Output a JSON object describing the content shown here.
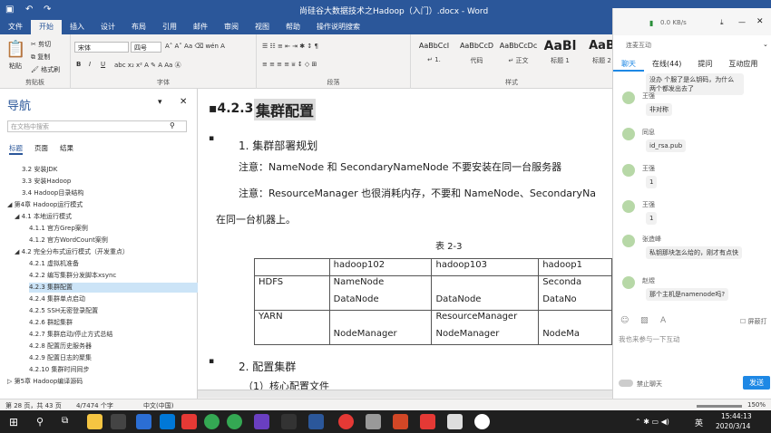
{
  "titlebar": {
    "title": "尚硅谷大数据技术之Hadoop（入门）.docx - Word"
  },
  "tabs": [
    "文件",
    "开始",
    "插入",
    "设计",
    "布局",
    "引用",
    "邮件",
    "审阅",
    "视图",
    "帮助",
    "操作说明搜索"
  ],
  "ribbon": {
    "clipboard": {
      "paste": "粘贴",
      "cut": "剪切",
      "copy": "复制",
      "format_painter": "格式刷",
      "label": "剪贴板"
    },
    "font": {
      "name": "宋体",
      "size": "四号",
      "label": "字体",
      "bold": "B",
      "italic": "I",
      "underline": "U"
    },
    "paragraph": {
      "label": "段落"
    },
    "styles": {
      "label": "样式",
      "items": [
        {
          "preview": "AaBbCcI",
          "name": "↵ 1."
        },
        {
          "preview": "AaBbCcD",
          "name": "代码"
        },
        {
          "preview": "AaBbCcDc",
          "name": "↵ 正文"
        },
        {
          "preview": "AaBl",
          "name": "标题 1"
        },
        {
          "preview": "AaB",
          "name": "标题 2"
        }
      ]
    }
  },
  "nav": {
    "title": "导航",
    "search_placeholder": "在文档中搜索",
    "tabs": [
      "标题",
      "页面",
      "结果"
    ],
    "items": [
      {
        "label": "3.2 安装JDK",
        "indent": 2,
        "sel": false
      },
      {
        "label": "3.3 安装Hadoop",
        "indent": 2,
        "sel": false
      },
      {
        "label": "3.4 Hadoop目录结构",
        "indent": 2,
        "sel": false
      },
      {
        "label": "◢ 第4章 Hadoop运行模式",
        "indent": 0,
        "sel": false
      },
      {
        "label": "◢ 4.1 本地运行模式",
        "indent": 1,
        "sel": false
      },
      {
        "label": "4.1.1 官方Grep案例",
        "indent": 3,
        "sel": false
      },
      {
        "label": "4.1.2 官方WordCount案例",
        "indent": 3,
        "sel": false
      },
      {
        "label": "◢ 4.2 完全分布式运行模式（开发重点）",
        "indent": 1,
        "sel": false
      },
      {
        "label": "4.2.1 虚拟机准备",
        "indent": 3,
        "sel": false
      },
      {
        "label": "4.2.2 编写集群分发脚本xsync",
        "indent": 3,
        "sel": false
      },
      {
        "label": "4.2.3 集群配置",
        "indent": 3,
        "sel": true
      },
      {
        "label": "4.2.4 集群单点启动",
        "indent": 3,
        "sel": false
      },
      {
        "label": "4.2.5 SSH无密登录配置",
        "indent": 3,
        "sel": false
      },
      {
        "label": "4.2.6 群起集群",
        "indent": 3,
        "sel": false
      },
      {
        "label": "4.2.7 集群启动/停止方式总结",
        "indent": 3,
        "sel": false
      },
      {
        "label": "4.2.8 配置历史服务器",
        "indent": 3,
        "sel": false
      },
      {
        "label": "4.2.9 配置日志的聚集",
        "indent": 3,
        "sel": false
      },
      {
        "label": "4.2.10 集群时间同步",
        "indent": 3,
        "sel": false
      },
      {
        "label": "▷ 第5章 Hadoop编译源码",
        "indent": 0,
        "sel": false
      }
    ]
  },
  "doc": {
    "heading_num": "4.2.3",
    "heading": "集群配置",
    "sub1": "1.   集群部署规划",
    "note1": "注意：NameNode 和 SecondaryNameNode 不要安装在同一台服务器",
    "note2": "注意：ResourceManager 也很消耗内存，不要和 NameNode、SecondaryNa",
    "note2b": "在同一台机器上。",
    "table_caption": "表 2-3",
    "table": [
      [
        "",
        "hadoop102",
        "hadoop103",
        "hadoop1"
      ],
      [
        "HDFS",
        "NameNode",
        "",
        "Seconda"
      ],
      [
        "",
        "DataNode",
        "DataNode",
        "DataNo"
      ],
      [
        "YARN",
        "",
        "ResourceManager",
        ""
      ],
      [
        "",
        "NodeManager",
        "NodeManager",
        "NodeMa"
      ]
    ],
    "sub2": "2.   配置集群",
    "sub3": "（1）核心配置文件"
  },
  "status": {
    "page": "第 28 页，共 43 页",
    "words": "4/7474 个字",
    "lang": "中文(中国)",
    "zoom": "150%"
  },
  "chat": {
    "net": "0.0 KB/s",
    "room": "连麦互动",
    "tabs": [
      "聊天",
      "在线(44)",
      "提问",
      "互动应用"
    ],
    "messages": [
      {
        "name": "",
        "text": "没办 个服了是么钥码，为什么两个都发出去了"
      },
      {
        "name": "王强",
        "text": "非对称"
      },
      {
        "name": "同息",
        "text": "id_rsa.pub"
      },
      {
        "name": "王强",
        "text": "1"
      },
      {
        "name": "王强",
        "text": "1"
      },
      {
        "name": "张造峰",
        "text": "私钥那块怎么给的，刚才有点快"
      },
      {
        "name": "赵煜",
        "text": "那个主机是namenode吗?"
      }
    ],
    "input_placeholder": "我也来参与一下互动",
    "mute_label": "禁止聊天",
    "send": "发送",
    "block_label": "屏蔽打"
  },
  "taskbar": {
    "time": "15:44:13",
    "date": "2020/3/14",
    "ime": "英"
  }
}
